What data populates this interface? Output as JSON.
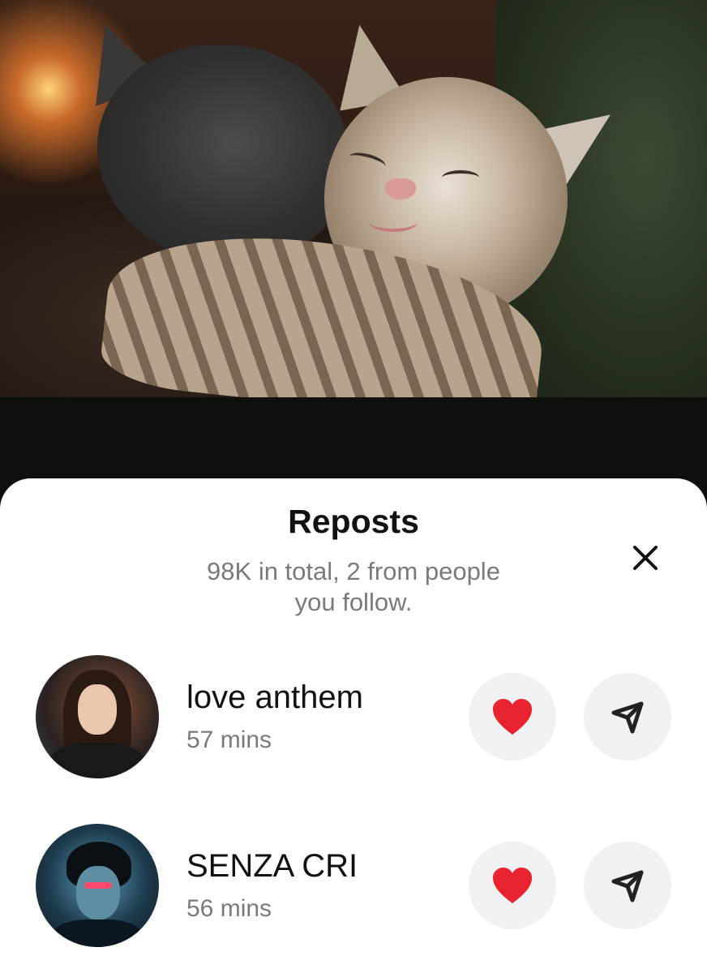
{
  "sheet": {
    "title": "Reposts",
    "subtitle": "98K in total, 2 from people you follow."
  },
  "icons": {
    "close": "close-icon",
    "like": "heart-icon",
    "share": "send-icon"
  },
  "colors": {
    "heart": "#e8222f",
    "button_bg": "#f1f1f1",
    "secondary_text": "#7a7a7a"
  },
  "reposts": [
    {
      "name": "love anthem",
      "time": "57 mins"
    },
    {
      "name": "SENZA CRI",
      "time": "56 mins"
    }
  ]
}
